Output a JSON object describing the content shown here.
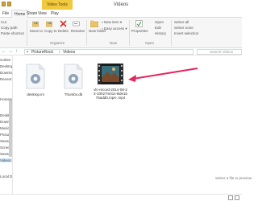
{
  "window": {
    "title": "Videos",
    "contextual_tab": "Video Tools"
  },
  "tabs": [
    "File",
    "Home",
    "Share",
    "View",
    "Play"
  ],
  "ribbon": {
    "clipboard": {
      "copy_path": "Copy path",
      "paste_shortcut": "Paste shortcut",
      "cut": "Cut"
    },
    "organize": {
      "label": "Organize",
      "move_to": "Move to",
      "copy_to": "Copy to",
      "delete": "Delete",
      "rename": "Rename"
    },
    "new": {
      "label": "New",
      "new_item": "New item",
      "easy_access": "Easy access",
      "new_folder": "New folder"
    },
    "open": {
      "label": "Open",
      "properties": "Properties",
      "open_item": "Open",
      "edit": "Edit",
      "history": "History"
    },
    "select": {
      "select_all": "Select all",
      "select_none": "Select none",
      "invert": "Invert selection"
    }
  },
  "address": {
    "segments": [
      "PictureRock",
      "Videos"
    ],
    "search_placeholder": "Search Videos"
  },
  "sidebar": {
    "items": [
      "vorites",
      "Desktop",
      "Downloads",
      "Recent places",
      "",
      "",
      "Homegroup",
      "",
      "",
      "Desktop",
      "Downloads",
      "Music",
      "Pictures",
      "Saved Photos",
      "Screenshots",
      "Saved Games",
      "Videos",
      "",
      "Local Disk",
      ""
    ]
  },
  "files": [
    {
      "name": "desktop.ini",
      "icon": "settings-file-icon"
    },
    {
      "name": "Thumbs.db",
      "icon": "settings-file-icon"
    },
    {
      "name": "vlc-record-2014-08-23-10h27m01s-Bde1b76add0.mp4-.mp4",
      "icon": "video-thumbnail-icon"
    }
  ],
  "preview_pane": {
    "text": "Select a file to preview."
  },
  "colors": {
    "arrow": "#e8245e",
    "accent_tab": "#f0c93e",
    "selected": "#cce8ff"
  }
}
